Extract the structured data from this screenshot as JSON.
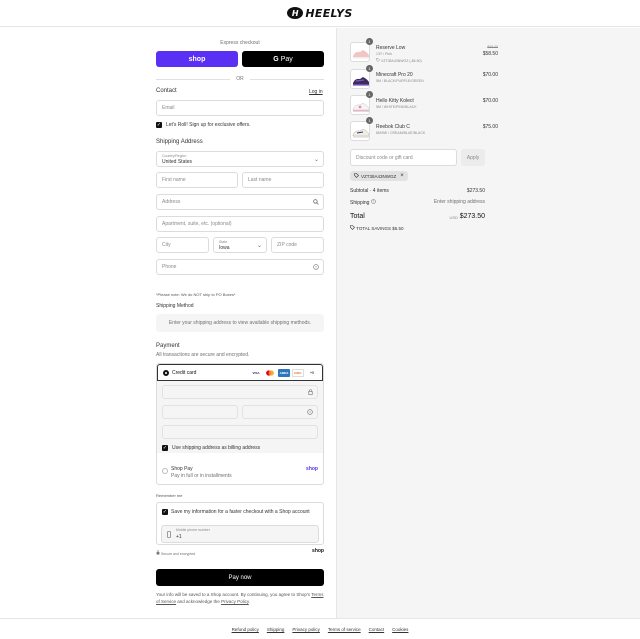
{
  "brand": {
    "name": "HEELYS",
    "mark": "H"
  },
  "express": {
    "title": "Express checkout",
    "shop_label": "shop",
    "gpay_label": "Pay",
    "gpay_g": "G",
    "or_label": "OR"
  },
  "contact": {
    "title": "Contact",
    "login_label": "Log in",
    "email_placeholder": "Email",
    "offers_label": "Let's Roll! Sign up for exclusive offers."
  },
  "shipping_address": {
    "title": "Shipping Address",
    "country_label": "Country/Region",
    "country_value": "United States",
    "first_name_placeholder": "First name",
    "last_name_placeholder": "Last name",
    "address_placeholder": "Address",
    "apartment_placeholder": "Apartment, suite, etc. (optional)",
    "city_placeholder": "City",
    "state_label": "State",
    "state_value": "Iowa",
    "zip_placeholder": "ZIP code",
    "phone_placeholder": "Phone",
    "po_note": "*Please note: We do NOT ship to PO Boxes*"
  },
  "shipping_method": {
    "title": "Shipping Method",
    "placeholder": "Enter your shipping address to view available shipping methods."
  },
  "payment": {
    "title": "Payment",
    "subtitle": "All transactions are secure and encrypted.",
    "credit_card_label": "Credit card",
    "card_logos": [
      "VISA",
      "MC",
      "AMEX",
      "DISC",
      "+5"
    ],
    "billing_label": "Use shipping address as billing address",
    "shop_pay_label": "Shop Pay",
    "shop_pay_sub": "Pay in full or in installments",
    "shop_pay_mark": "shop"
  },
  "remember": {
    "title": "Remember me",
    "save_label": "Save my information for a faster checkout with a Shop account",
    "phone_label": "Mobile phone number",
    "phone_value": "+1",
    "secure_label": "Secure and encrypted",
    "shop_mark": "shop"
  },
  "pay_now_label": "Pay now",
  "legal": {
    "text_1": "Your info will be saved to a Shop account. By continuing, you agree to Shop's ",
    "terms": "Terms of Service",
    "text_2": " and acknowledge the ",
    "privacy": "Privacy Policy",
    "text_3": "."
  },
  "footer_links": [
    "Refund policy",
    "Shipping",
    "Privacy policy",
    "Terms of service",
    "Contact",
    "Cookies"
  ],
  "order": {
    "items": [
      {
        "name": "Reserve Low",
        "variant": "13Y / Pink",
        "discount": "VZT38A43NWGZ (-$6.50)",
        "orig_price": "$65.00",
        "price": "$58.50",
        "qty": "1"
      },
      {
        "name": "Minecraft Pro 20",
        "variant": "5M / BLACK/PURPLE/GREEN",
        "discount": "",
        "orig_price": "",
        "price": "$70.00",
        "qty": "1"
      },
      {
        "name": "Hello Kitty Kolect",
        "variant": "5M / WHITE/PINK/BLACK",
        "discount": "",
        "orig_price": "",
        "price": "$70.00",
        "qty": "1"
      },
      {
        "name": "Reebok Club C",
        "variant": "8M/9W / CREAM/BLUE/BLACK",
        "discount": "",
        "orig_price": "",
        "price": "$75.00",
        "qty": "1"
      }
    ],
    "discount_placeholder": "Discount code or gift card",
    "apply_label": "Apply",
    "applied_code": "VZT38A43NWGZ",
    "subtotal_label": "Subtotal · 4 items",
    "subtotal_value": "$273.50",
    "shipping_label": "Shipping",
    "shipping_value": "Enter shipping address",
    "total_label": "Total",
    "currency": "USD",
    "total_value": "$273.50",
    "savings_label": "TOTAL SAVINGS $6.50"
  }
}
